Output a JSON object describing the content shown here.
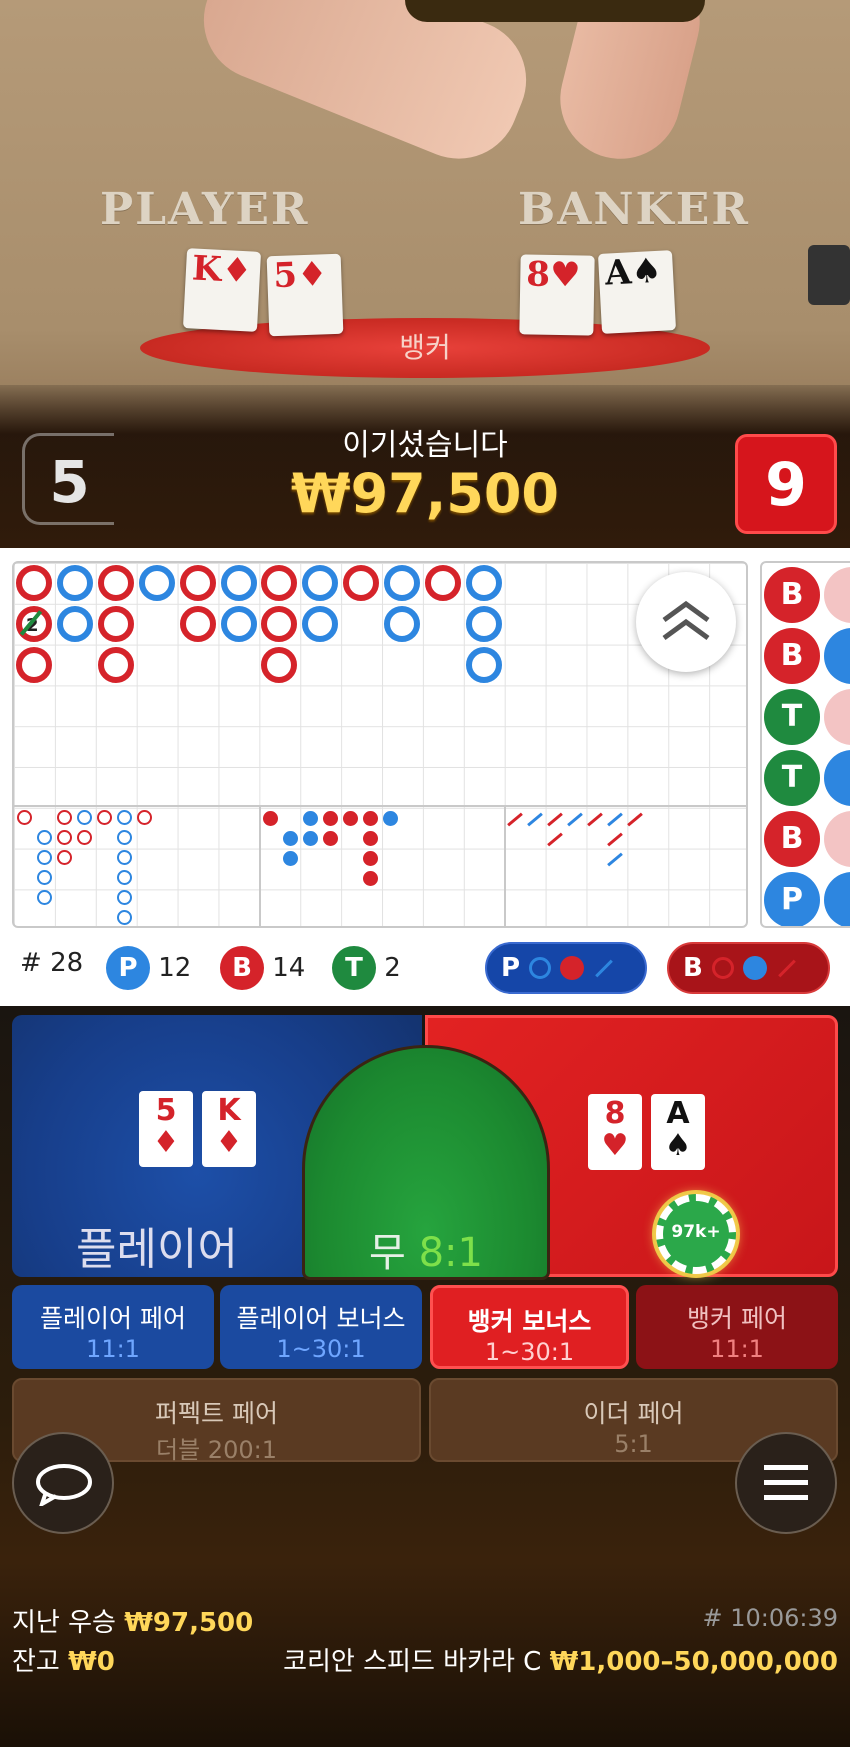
{
  "table": {
    "player_label": "PLAYER",
    "banker_label": "BANKER",
    "outcome_label": "뱅커"
  },
  "result": {
    "message": "이기셨습니다",
    "amount": "₩97,500",
    "player_score": "5",
    "banker_score": "9"
  },
  "table_cards": {
    "player": [
      {
        "rank": "K",
        "suit": "♦"
      },
      {
        "rank": "5",
        "suit": "♦"
      }
    ],
    "banker": [
      {
        "rank": "8",
        "suit": "♥"
      },
      {
        "rank": "A",
        "suit": "♠"
      }
    ]
  },
  "stats": {
    "round_prefix": "#",
    "rounds": "28",
    "player_letter": "P",
    "player_count": "12",
    "banker_letter": "B",
    "banker_count": "14",
    "tie_letter": "T",
    "tie_count": "2"
  },
  "predict": {
    "player_letter": "P",
    "banker_letter": "B"
  },
  "bead_road": [
    "B",
    "B",
    "T",
    "T",
    "B",
    "P"
  ],
  "tie_marker": "2",
  "bets": {
    "player": {
      "label": "플레이어",
      "cards": [
        {
          "rank": "5",
          "suit": "♦"
        },
        {
          "rank": "K",
          "suit": "♦"
        }
      ]
    },
    "tie": {
      "label": "무",
      "odds": "8:1"
    },
    "banker": {
      "cards": [
        {
          "rank": "8",
          "suit": "♥"
        },
        {
          "rank": "A",
          "suit": "♠"
        }
      ],
      "chip": "97k+"
    },
    "side": [
      {
        "name": "플레이어 페어",
        "odds": "11:1"
      },
      {
        "name": "플레이어 보너스",
        "odds": "1~30:1"
      },
      {
        "name": "뱅커 보너스",
        "odds": "1~30:1"
      },
      {
        "name": "뱅커 페어",
        "odds": "11:1"
      }
    ],
    "perfect": {
      "name": "퍼펙트 페어",
      "odds": "더블 200:1"
    },
    "either": {
      "name": "이더 페어",
      "odds": "5:1"
    }
  },
  "footer": {
    "last_win_label": "지난 우승",
    "last_win": "₩97,500",
    "balance_label": "잔고",
    "balance": "₩0",
    "round_id": "# 10:06:39",
    "table_name": "코리안 스피드 바카라 C",
    "limits": "₩1,000–50,000,000"
  },
  "colors": {
    "banker": "#d5232a",
    "player": "#2d86e0",
    "tie": "#1f8a3f",
    "gold": "#ffd75a"
  },
  "icons": {
    "collapse": "double-chevron-up-icon",
    "chat": "chat-bubble-icon",
    "menu": "hamburger-menu-icon"
  }
}
